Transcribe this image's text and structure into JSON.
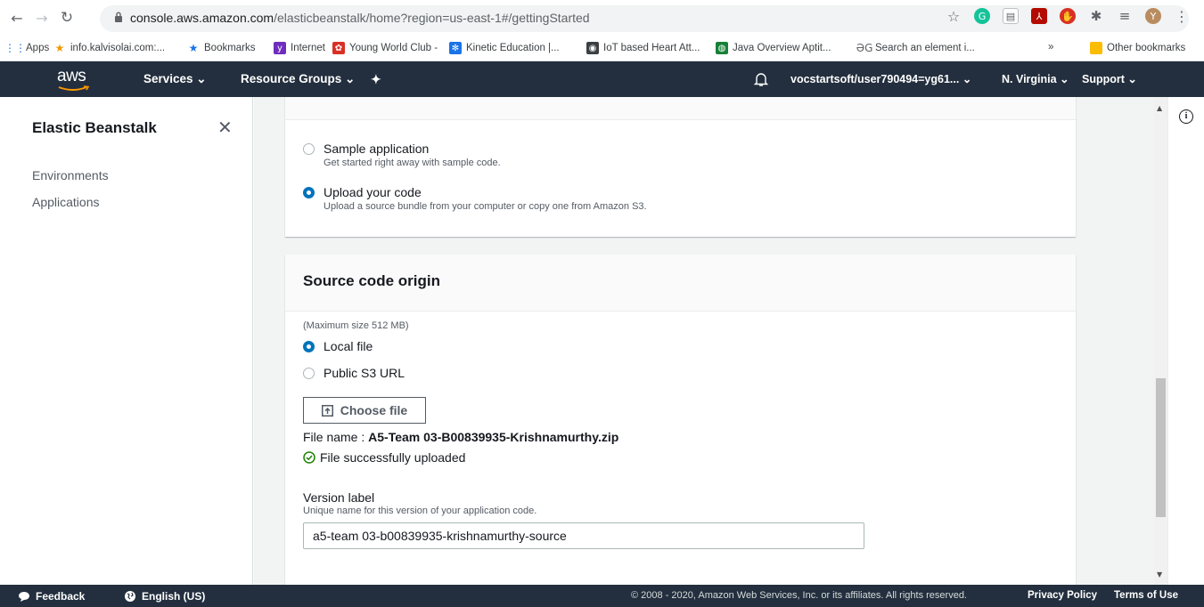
{
  "browser": {
    "url_host": "console.aws.amazon.com",
    "url_path": "/elasticbeanstalk/home?region=us-east-1#/gettingStarted",
    "avatar_letter": "Y",
    "bookmarks": [
      {
        "label": "Apps",
        "color": "#1a73e8",
        "glyph": "⋮⋮"
      },
      {
        "label": "info.kalvisolai.com:...",
        "color": "#f29900",
        "glyph": "★"
      },
      {
        "label": "Bookmarks",
        "color": "#1a73e8",
        "glyph": "★"
      },
      {
        "label": "Internet",
        "color": "#6f2dbd",
        "glyph": "y"
      },
      {
        "label": "Young World Club -",
        "color": "#d93025",
        "glyph": "✿"
      },
      {
        "label": "Kinetic Education |...",
        "color": "#1a73e8",
        "glyph": "✻"
      },
      {
        "label": "IoT based Heart Att...",
        "color": "#3c4043",
        "glyph": "◉"
      },
      {
        "label": "Java Overview Aptit...",
        "color": "#188038",
        "glyph": "◍"
      },
      {
        "label": "Search an element i...",
        "color": "#5f6368",
        "glyph": "ƏG"
      },
      {
        "label": "»",
        "color": "#5f6368",
        "glyph": ""
      },
      {
        "label": "Other bookmarks",
        "color": "#fbbc04",
        "glyph": ""
      }
    ]
  },
  "aws_header": {
    "logo": "aws",
    "services": "Services ⌄",
    "resource_groups": "Resource Groups ⌄",
    "account": "vocstartsoft/user790494=yg61... ⌄",
    "region": "N. Virginia ⌄",
    "support": "Support ⌄"
  },
  "sidebar": {
    "title": "Elastic Beanstalk",
    "close_glyph": "✕",
    "items": [
      {
        "label": "Environments"
      },
      {
        "label": "Applications"
      }
    ]
  },
  "app_code": {
    "options": [
      {
        "label": "Sample application",
        "desc": "Get started right away with sample code.",
        "selected": false
      },
      {
        "label": "Upload your code",
        "desc": "Upload a source bundle from your computer or copy one from Amazon S3.",
        "selected": true
      }
    ]
  },
  "source_origin": {
    "title": "Source code origin",
    "max_size": "(Maximum size 512 MB)",
    "options": [
      {
        "label": "Local file",
        "selected": true
      },
      {
        "label": "Public S3 URL",
        "selected": false
      }
    ],
    "choose_file_label": "Choose file",
    "file_name_prefix": "File name : ",
    "file_name": "A5-Team 03-B00839935-Krishnamurthy.zip",
    "upload_status": "File successfully uploaded",
    "status_color": "#1d8102",
    "version_label": "Version label",
    "version_desc": "Unique name for this version of your application code.",
    "version_value": "a5-team 03-b00839935-krishnamurthy-source"
  },
  "footer": {
    "feedback": "Feedback",
    "language": "English (US)",
    "copyright": "© 2008 - 2020, Amazon Web Services, Inc. or its affiliates. All rights reserved.",
    "privacy": "Privacy Policy",
    "terms": "Terms of Use"
  }
}
